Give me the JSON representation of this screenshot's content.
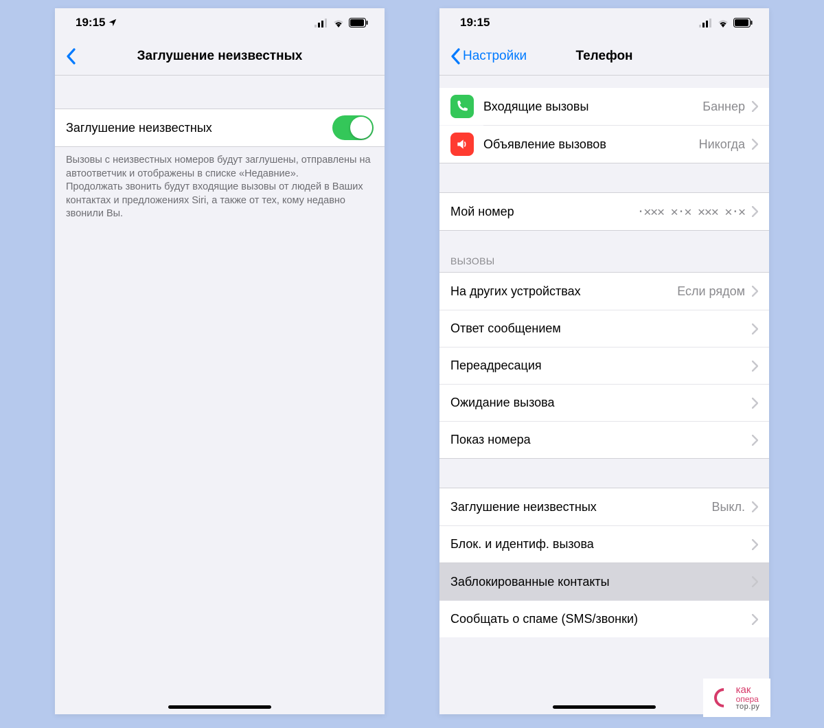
{
  "left": {
    "status_time": "19:15",
    "nav_title": "Заглушение неизвестных",
    "toggle_row": {
      "label": "Заглушение неизвестных",
      "on": true
    },
    "footer": "Вызовы с неизвестных номеров будут заглушены, отправлены на автоответчик и отображены в списке «Недавние».\nПродолжать звонить будут входящие вызовы от людей в Ваших контактах и предложениях Siri, а также от тех, кому недавно звонили Вы."
  },
  "right": {
    "status_time": "19:15",
    "nav_back": "Настройки",
    "nav_title": "Телефон",
    "top_rows": [
      {
        "icon": "phone-in",
        "icon_color": "green",
        "label": "Входящие вызовы",
        "value": "Баннер"
      },
      {
        "icon": "announce",
        "icon_color": "red",
        "label": "Объявление вызовов",
        "value": "Никогда"
      }
    ],
    "my_number": {
      "label": "Мой номер",
      "value": "·✕✕✕ ✕·✕ ✕✕✕ ✕·✕"
    },
    "calls_header": "ВЫЗОВЫ",
    "calls_rows": [
      {
        "label": "На других устройствах",
        "value": "Если рядом"
      },
      {
        "label": "Ответ сообщением",
        "value": ""
      },
      {
        "label": "Переадресация",
        "value": ""
      },
      {
        "label": "Ожидание вызова",
        "value": ""
      },
      {
        "label": "Показ номера",
        "value": ""
      }
    ],
    "silence_rows": [
      {
        "label": "Заглушение неизвестных",
        "value": "Выкл."
      },
      {
        "label": "Блок. и идентиф. вызова",
        "value": ""
      }
    ],
    "blocked_rows": [
      {
        "label": "Заблокированные контакты",
        "value": "",
        "pressed": true
      },
      {
        "label": "Сообщать о спаме (SMS/звонки)",
        "value": ""
      }
    ]
  },
  "watermark": {
    "line1": "как",
    "line2": "опера",
    "line3": "тор.ру"
  }
}
